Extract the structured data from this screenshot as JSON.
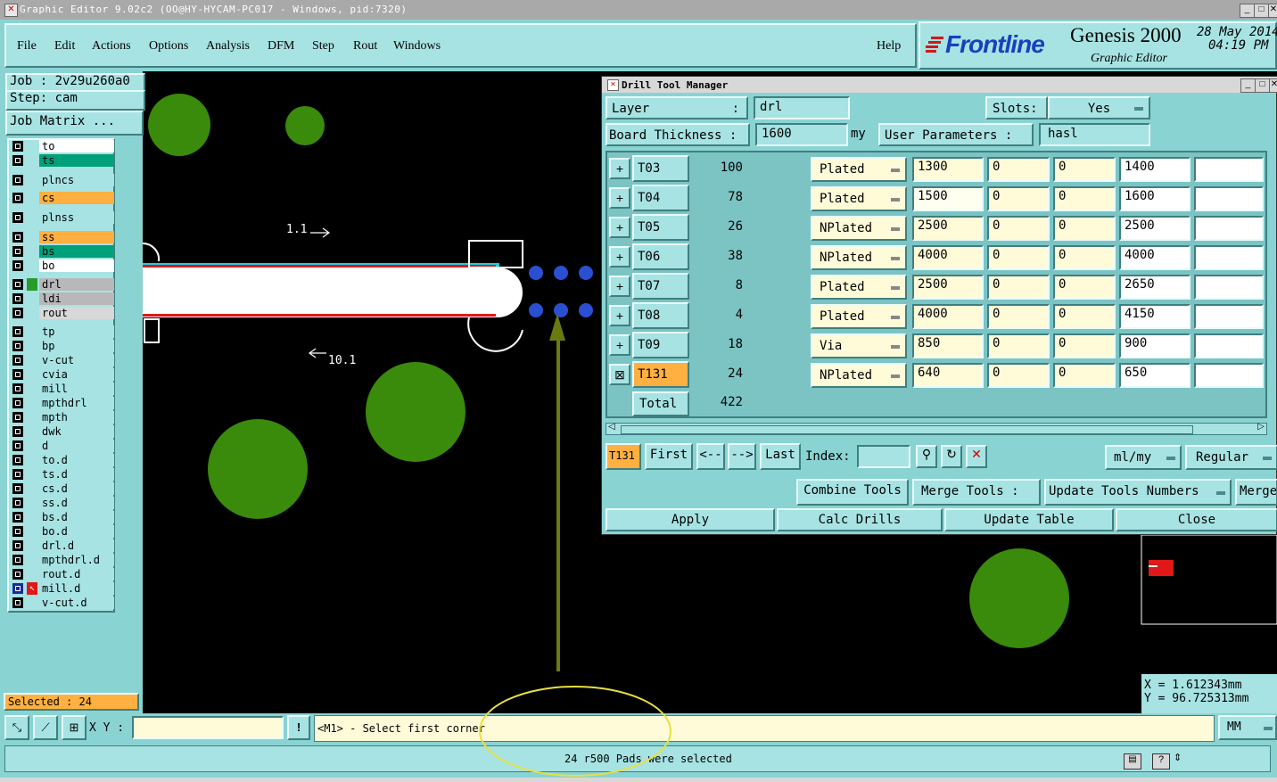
{
  "window": {
    "title": "Graphic Editor 9.02c2 (OO@HY-HYCAM-PC017 - Windows, pid:7320)"
  },
  "menu": [
    "File",
    "Edit",
    "Actions",
    "Options",
    "Analysis",
    "DFM",
    "Step",
    "Rout",
    "Windows"
  ],
  "help": "Help",
  "brand": {
    "logo": "Frontline",
    "product": "Genesis 2000",
    "subtitle": "Graphic Editor",
    "date": "28 May 2014",
    "time": "04:19 PM"
  },
  "job": {
    "job": "Job : 2v29u260a0",
    "step": "Step: cam",
    "matrix_button": "Job Matrix ..."
  },
  "layers": [
    {
      "name": "to",
      "color": "#ffffff"
    },
    {
      "name": "ts",
      "color": "#00a07a"
    },
    {
      "name": "plncs",
      "color": "#a7e3e3"
    },
    {
      "name": "cs",
      "color": "#ffb040"
    },
    {
      "name": "plnss",
      "color": "#a7e3e3"
    },
    {
      "name": "ss",
      "color": "#ffb040"
    },
    {
      "name": "bs",
      "color": "#00a07a"
    },
    {
      "name": "bo",
      "color": "#ffffff"
    },
    {
      "name": "drl",
      "color": "#b8b8b8"
    },
    {
      "name": "ldi",
      "color": "#b8b8b8"
    },
    {
      "name": "rout",
      "color": "#d8d8d8"
    },
    {
      "name": "tp",
      "color": "#a7e3e3"
    },
    {
      "name": "bp",
      "color": "#a7e3e3"
    },
    {
      "name": "v-cut",
      "color": "#a7e3e3"
    },
    {
      "name": "cvia",
      "color": "#a7e3e3"
    },
    {
      "name": "mill",
      "color": "#a7e3e3"
    },
    {
      "name": "mpthdrl",
      "color": "#a7e3e3"
    },
    {
      "name": "mpth",
      "color": "#a7e3e3"
    },
    {
      "name": "dwk",
      "color": "#a7e3e3"
    },
    {
      "name": "d",
      "color": "#a7e3e3"
    },
    {
      "name": "to.d",
      "color": "#a7e3e3"
    },
    {
      "name": "ts.d",
      "color": "#a7e3e3"
    },
    {
      "name": "cs.d",
      "color": "#a7e3e3"
    },
    {
      "name": "ss.d",
      "color": "#a7e3e3"
    },
    {
      "name": "bs.d",
      "color": "#a7e3e3"
    },
    {
      "name": "bo.d",
      "color": "#a7e3e3"
    },
    {
      "name": "drl.d",
      "color": "#a7e3e3"
    },
    {
      "name": "mpthdrl.d",
      "color": "#a7e3e3"
    },
    {
      "name": "rout.d",
      "color": "#a7e3e3"
    },
    {
      "name": "mill.d",
      "color": "#a7e3e3"
    },
    {
      "name": "v-cut.d",
      "color": "#a7e3e3"
    }
  ],
  "selected": "Selected : 24",
  "canvas": {
    "label_a": "1.1",
    "label_b": "10.1"
  },
  "dtm": {
    "title": "Drill Tool Manager",
    "layer_label": "Layer",
    "layer_value": "drl",
    "slots_label": "Slots:",
    "slots_value": "Yes",
    "thickness_label": "Board Thickness :",
    "thickness_value": "1600",
    "thickness_unit": "my",
    "userparams_label": "User Parameters :",
    "userparams_value": "hasl",
    "rows": [
      {
        "tool": "T03",
        "count": "100",
        "type": "Plated",
        "size": "1300",
        "a": "0",
        "b": "0",
        "finish": "1400"
      },
      {
        "tool": "T04",
        "count": "78",
        "type": "Plated",
        "size": "1500",
        "a": "0",
        "b": "0",
        "finish": "1600"
      },
      {
        "tool": "T05",
        "count": "26",
        "type": "NPlated",
        "size": "2500",
        "a": "0",
        "b": "0",
        "finish": "2500"
      },
      {
        "tool": "T06",
        "count": "38",
        "type": "NPlated",
        "size": "4000",
        "a": "0",
        "b": "0",
        "finish": "4000"
      },
      {
        "tool": "T07",
        "count": "8",
        "type": "Plated",
        "size": "2500",
        "a": "0",
        "b": "0",
        "finish": "2650"
      },
      {
        "tool": "T08",
        "count": "4",
        "type": "Plated",
        "size": "4000",
        "a": "0",
        "b": "0",
        "finish": "4150"
      },
      {
        "tool": "T09",
        "count": "18",
        "type": "Via",
        "size": "850",
        "a": "0",
        "b": "0",
        "finish": "900"
      },
      {
        "tool": "T131",
        "count": "24",
        "type": "NPlated",
        "size": "640",
        "a": "0",
        "b": "0",
        "finish": "650"
      }
    ],
    "total_label": "Total",
    "total_value": "422",
    "current_tool": "T131",
    "nav": {
      "first": "First",
      "prev": "<--",
      "next": "-->",
      "last": "Last",
      "index_label": "Index:",
      "units": "ml/my",
      "mode": "Regular"
    },
    "actions": {
      "combine": "Combine Tools",
      "merge_tools": "Merge Tools :",
      "update_numbers": "Update Tools Numbers",
      "merge": "Merge"
    },
    "buttons": {
      "apply": "Apply",
      "calc": "Calc Drills",
      "update": "Update Table",
      "close": "Close"
    }
  },
  "coords": {
    "x": "X = 1.612343mm",
    "y": "Y = 96.725313mm"
  },
  "bottom": {
    "xy_label": "X Y :",
    "prompt": "<M1> - Select first corner",
    "units": "MM",
    "status": "24 r500 Pads were selected"
  }
}
